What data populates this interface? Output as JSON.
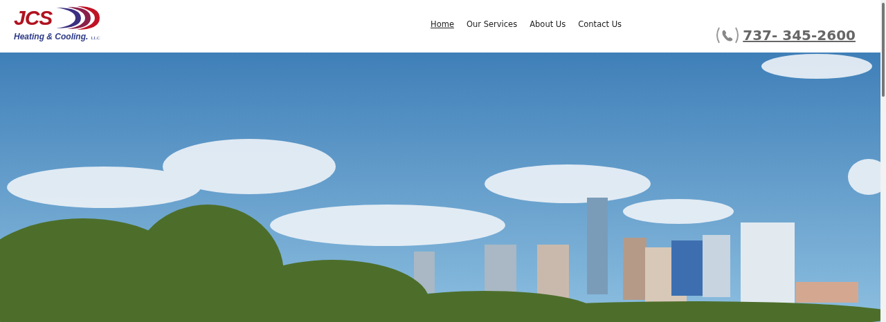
{
  "logo": {
    "name": "JCS",
    "tagline": "Heating & Cooling.",
    "suffix": "LLC"
  },
  "nav": [
    {
      "label": "Home",
      "selected": true
    },
    {
      "label": "Our Services",
      "selected": false
    },
    {
      "label": "About Us",
      "selected": false
    },
    {
      "label": "Contact Us",
      "selected": false
    }
  ],
  "phone": "737- 345-2600"
}
